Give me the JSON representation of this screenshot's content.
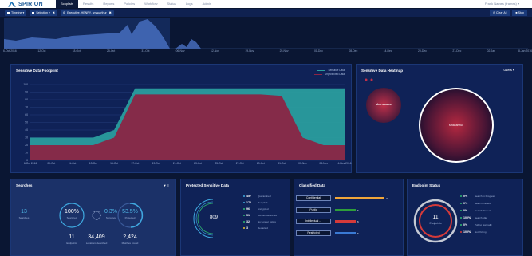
{
  "nav": {
    "logo": "SPIRION",
    "tabs": [
      "Scoplists",
      "Results",
      "Reports",
      "Policies",
      "Workflow",
      "Status",
      "Logs",
      "Admin"
    ],
    "active_tab": "Scoplists",
    "user": "Frank Names (frames) ▾"
  },
  "filterbar": {
    "chips": [
      {
        "label": "Timeline ▾"
      },
      {
        "label": "Selection ▾"
      },
      {
        "label": "Executive, HENRY, smacarthur"
      }
    ],
    "clear_all": "Clear All",
    "stop": "Stop"
  },
  "timeline": {
    "ticks": [
      "6-Oct 2016",
      "12-Oct",
      "18-Oct",
      "25-Oct",
      "31-Oct",
      "06-Nov",
      "12-Nov",
      "19-Nov",
      "25-Nov",
      "01-Dec",
      "08-Dec",
      "14-Dec",
      "20-Dec",
      "27-Dec",
      "02-Jan",
      "8-Jan 2016"
    ]
  },
  "footprint": {
    "title": "Sensitive Data Footprint",
    "legend": [
      "Sensitive Data",
      "Unprotected Data"
    ],
    "colors": {
      "sensitive": "#2a9d9e",
      "unprotected": "#8a2545"
    }
  },
  "chart_data": {
    "type": "area",
    "x": [
      "6-Oct 2016",
      "09-Oct",
      "11-Oct",
      "13-Oct",
      "15-Oct",
      "17-Oct",
      "19-Oct",
      "21-Oct",
      "23-Oct",
      "25-Oct",
      "27-Oct",
      "29-Oct",
      "31-Oct",
      "01-Nov",
      "03-Nov",
      "4-Nov 2016"
    ],
    "series": [
      {
        "name": "Sensitive Data",
        "values": [
          30,
          30,
          30,
          30,
          40,
          95,
          95,
          95,
          95,
          95,
          95,
          95,
          95,
          95,
          95,
          95
        ]
      },
      {
        "name": "Unprotected Data",
        "values": [
          20,
          20,
          20,
          20,
          30,
          87,
          87,
          87,
          87,
          87,
          87,
          87,
          85,
          30,
          20,
          20
        ]
      }
    ],
    "yticks": [
      0,
      10,
      20,
      30,
      40,
      50,
      60,
      70,
      80,
      90,
      100
    ],
    "ylim": [
      0,
      100
    ]
  },
  "heatmap": {
    "title": "Sensitive Data Heatmap",
    "dropdown": "Users",
    "bubbles": [
      {
        "label": "shernandez"
      },
      {
        "label": "smacarthur"
      }
    ]
  },
  "searches": {
    "title": "Searches",
    "searches_count": "13",
    "searches_label": "Searches",
    "pct1": "100%",
    "pct1_label": "Searched",
    "pct2": "0.3%",
    "pct2_label": "Sensitive",
    "pct3": "53.5%",
    "pct3_label": "Protected",
    "endpoints": "11",
    "endpoints_label": "Endpoints",
    "locations": "34,409",
    "locations_label": "Locations Searched",
    "matches": "2,424",
    "matches_label": "Matches Found"
  },
  "protected": {
    "title": "Protected Sensitive Data",
    "total": "809",
    "rows": [
      {
        "num": "457",
        "label": "Quarantined",
        "color": "#3fa9e0"
      },
      {
        "num": "170",
        "label": "Recycled",
        "color": "#3fa9e0"
      },
      {
        "num": "96",
        "label": "Encrypted",
        "color": "#2eb872"
      },
      {
        "num": "51",
        "label": "Access Restricted",
        "color": "#2eb872"
      },
      {
        "num": "32",
        "label": "No Longer Exists",
        "color": "#2eb872"
      },
      {
        "num": "3",
        "label": "Redacted",
        "color": "#e8c230"
      }
    ]
  },
  "classified": {
    "title": "Classified Data",
    "rows": [
      {
        "label": "Confidential",
        "value": "74",
        "color": "#f0a63a"
      },
      {
        "label": "Public",
        "value": "6",
        "color": "#2e9d3a"
      },
      {
        "label": "Intellectual ...",
        "value": "6",
        "color": "#d43a3a"
      },
      {
        "label": "Restricted",
        "value": "6",
        "color": "#3a7ad4"
      }
    ]
  },
  "endpoint": {
    "title": "Endpoint Status",
    "count": "11",
    "count_label": "Endpoints",
    "rows": [
      {
        "num": "0%",
        "label": "Search In Progress",
        "color": "#2eb872"
      },
      {
        "num": "0%",
        "label": "Search Paused",
        "color": "#2eb872"
      },
      {
        "num": "0%",
        "label": "Search Stalled",
        "color": "#2eb872"
      },
      {
        "num": "100%",
        "label": "Search Idle",
        "color": "#2eb872"
      },
      {
        "num": "0%",
        "label": "Polling Normally",
        "color": "#2eb872"
      },
      {
        "num": "100%",
        "label": "Not Polling",
        "color": "#d43a3a"
      }
    ]
  }
}
